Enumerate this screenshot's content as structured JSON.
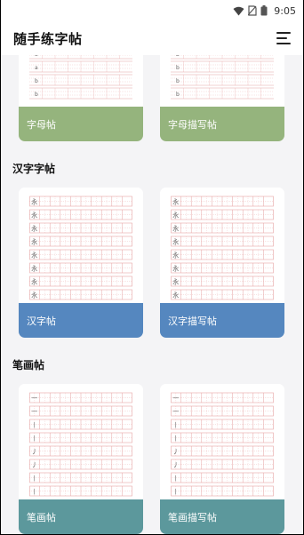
{
  "status_bar": {
    "time": "9:05",
    "icons": [
      "wifi-icon",
      "no-sim-icon",
      "battery-icon"
    ]
  },
  "app_bar": {
    "title": "随手练字帖",
    "menu_icon": "hamburger-menu-icon"
  },
  "sections": [
    {
      "title": "",
      "color": "#95b47d",
      "cards": [
        {
          "label": "字母帖",
          "sample_chars": [
            "a",
            "a",
            "b",
            "b"
          ]
        },
        {
          "label": "字母描写帖",
          "sample_chars": [
            "b",
            "b",
            "b",
            "b"
          ]
        }
      ]
    },
    {
      "title": "汉字字帖",
      "color": "#5587bf",
      "cards": [
        {
          "label": "汉字帖",
          "sample_chars": [
            "永",
            "永",
            "永",
            "永",
            "永",
            "永",
            "永",
            "永"
          ]
        },
        {
          "label": "汉字描写帖",
          "sample_chars": [
            "永",
            "永",
            "永",
            "永",
            "永",
            "永",
            "永",
            "永"
          ]
        }
      ]
    },
    {
      "title": "笔画帖",
      "color": "#5c989c",
      "cards": [
        {
          "label": "笔画帖",
          "sample_chars": [
            "一",
            "一",
            "丨",
            "丨",
            "丿",
            "丿",
            "丨",
            "丨"
          ]
        },
        {
          "label": "笔画描写帖",
          "sample_chars": [
            "一",
            "一",
            "丨",
            "丨",
            "丿",
            "丿",
            "丨",
            "丨"
          ]
        }
      ]
    }
  ],
  "colors": {
    "grid_line": "#e6a3a3",
    "background": "#f4f4f6"
  }
}
